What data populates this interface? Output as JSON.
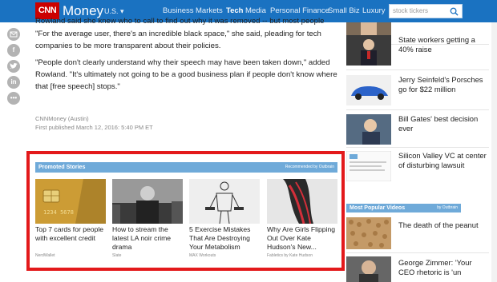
{
  "header": {
    "logo_cnn": "CNN",
    "logo_money": "Money",
    "region": "U.S. ▾",
    "nav": [
      "Business",
      "Markets",
      "Tech",
      "Media",
      "Personal Finance",
      "Small Biz",
      "Luxury"
    ],
    "active_nav": "Tech",
    "search_placeholder": "stock tickers",
    "color_bar": "#1a72c1",
    "color_logo": "#cc0000"
  },
  "share_icons": [
    "email-icon",
    "facebook-icon",
    "twitter-icon",
    "linkedin-icon",
    "more-icon"
  ],
  "article": {
    "p0": "Rowland said she knew who to call to find out why it was removed -- but most people don't.",
    "p1": "\"For the average user, there's an incredible black space,\" she said, pleading for tech companies to be more transparent about their policies.",
    "p2": "\"People don't clearly understand why their speech may have been taken down,\" added Rowland. \"It's ultimately not going to be a good business plan if people don't know where that [free speech] stops.\"",
    "source": "CNNMoney (Austin)",
    "published": "First published March 12, 2016: 5:40 PM ET"
  },
  "promoted": {
    "title": "Promoted Stories",
    "recommended": "Recommended by Outbrain",
    "highlight_color": "#e3191b",
    "items": [
      {
        "title": "Top 7 cards for people with excellent credit",
        "source": "NerdWallet"
      },
      {
        "title": "How to stream the latest LA noir crime drama",
        "source": "Slate"
      },
      {
        "title": "5 Exercise Mistakes That Are Destroying Your Metabolism",
        "source": "MAX Workouts"
      },
      {
        "title": "Why Are Girls Flipping Out Over Kate Hudson's New...",
        "source": "Fabletics by Kate Hudson"
      }
    ]
  },
  "rail": {
    "stories": [
      {
        "title": ""
      },
      {
        "title": "State workers getting a 40% raise"
      },
      {
        "title": "Jerry Seinfeld's Porsches go for $22 million"
      },
      {
        "title": "Bill Gates' best decision ever"
      },
      {
        "title": "Silicon Valley VC at center of disturbing lawsuit"
      },
      {
        "title": "The death of the peanut"
      },
      {
        "title": "George Zimmer: 'Your CEO rhetoric is 'un"
      }
    ],
    "most_popular_title": "Most Popular Videos",
    "most_popular_by": "by Outbrain"
  }
}
